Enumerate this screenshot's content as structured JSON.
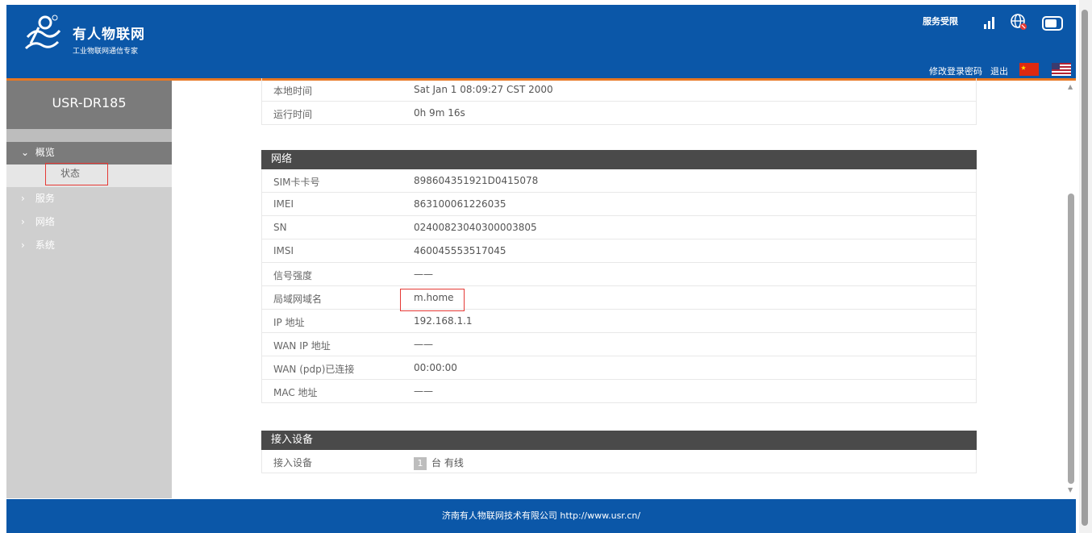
{
  "header": {
    "brand_name": "有人物联网",
    "brand_slogan": "工业物联网通信专家",
    "service_limit": "服务受限",
    "change_password": "修改登录密码",
    "logout": "退出",
    "icons": [
      "signal-icon",
      "globe-icon",
      "sim-card-icon",
      "china-flag-icon",
      "us-flag-icon"
    ]
  },
  "sidebar": {
    "device_name": "USR-DR185",
    "group": "概览",
    "active_item": "状态",
    "items": [
      "服务",
      "网络",
      "系统"
    ]
  },
  "system_rows": [
    {
      "key": "本地时间",
      "value": "Sat Jan 1 08:09:27 CST 2000"
    },
    {
      "key": "运行时间",
      "value": "0h 9m 16s"
    }
  ],
  "network": {
    "title": "网络",
    "rows": [
      {
        "key": "SIM卡卡号",
        "value": "898604351921D0415078"
      },
      {
        "key": "IMEI",
        "value": "863100061226035"
      },
      {
        "key": "SN",
        "value": "02400823040300003805"
      },
      {
        "key": "IMSI",
        "value": "460045553517045"
      },
      {
        "key": "信号强度",
        "value": "——"
      },
      {
        "key": "局域网域名",
        "value": "m.home"
      },
      {
        "key": "IP 地址",
        "value": "192.168.1.1"
      },
      {
        "key": "WAN IP 地址",
        "value": "——"
      },
      {
        "key": "WAN (pdp)已连接",
        "value": "00:00:00"
      },
      {
        "key": "MAC 地址",
        "value": "——"
      }
    ]
  },
  "devices": {
    "title": "接入设备",
    "key": "接入设备",
    "count": "1",
    "suffix": "台 有线"
  },
  "footer": {
    "text": "济南有人物联网技术有限公司  http://www.usr.cn/"
  },
  "colors": {
    "header_blue": "#0b57a8",
    "accent_orange": "#e87722",
    "highlight_red": "#e53935"
  }
}
